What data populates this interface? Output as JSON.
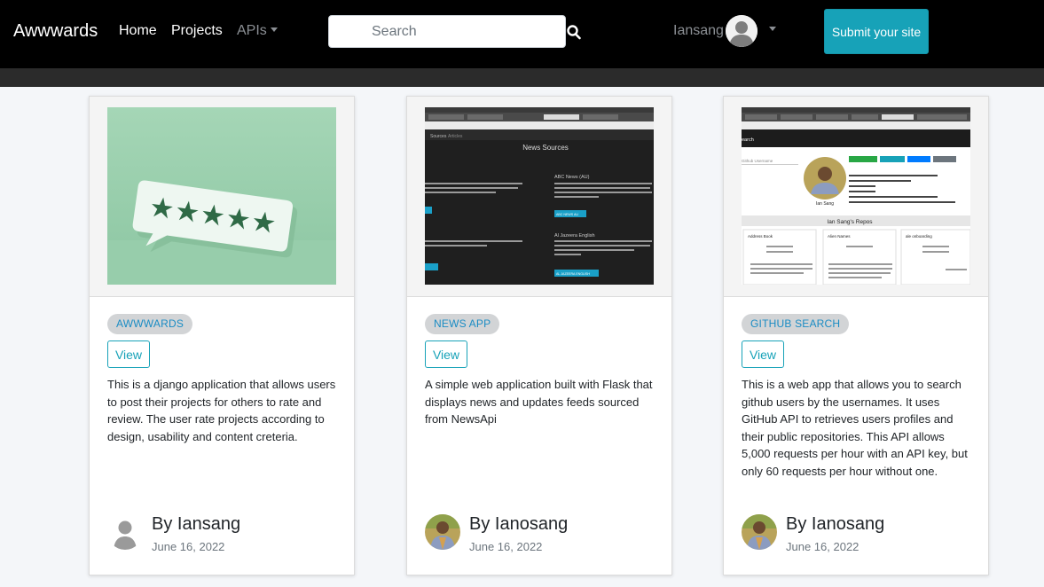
{
  "navbar": {
    "brand": "Awwwards",
    "links": {
      "home": "Home",
      "projects": "Projects",
      "apis": "APIs"
    },
    "search": {
      "placeholder": "Search",
      "value": ""
    },
    "user": {
      "name": "Iansang"
    },
    "submit_label": "Submit your site"
  },
  "colors": {
    "navbar": "#000000",
    "accent": "#17a2b8",
    "badge_bg": "#d2d4d6",
    "badge_text": "#1a8cc4"
  },
  "cards": [
    {
      "badge": "AWWWARDS",
      "view_label": "View",
      "description": "This is a django application that allows users to post their projects for others to rate and review. The user rate projects according to design, usability and content creteria.",
      "author": "By Iansang",
      "date": "June 16, 2022",
      "author_avatar": "default-user-icon",
      "thumbnail": "rating-stars-image"
    },
    {
      "badge": "NEWS APP",
      "view_label": "View",
      "description": "A simple web application built with Flask that displays news and updates feeds sourced from NewsApi",
      "author": "By Ianosang",
      "date": "June 16, 2022",
      "author_avatar": "profile-photo",
      "thumbnail": "news-app-screenshot",
      "thumbnail_text": {
        "header": "News Sources",
        "nav": [
          "Sources",
          "Articles"
        ],
        "source_1": "ABC News (AU)",
        "source_2": "Al Jazeera English",
        "button_1": "ABC NEWS AU",
        "button_2": "AL JAZEERA ENGLISH"
      }
    },
    {
      "badge": "GITHUB SEARCH",
      "view_label": "View",
      "description": "This is a web app that allows you to search github users by the usernames. It uses GitHub API to retrieves users profiles and their public repositories. This API allows 5,000 requests per hour with an API key, but only 60 requests per hour without one.",
      "author": "By Ianosang",
      "date": "June 16, 2022",
      "author_avatar": "profile-photo",
      "thumbnail": "github-search-screenshot",
      "thumbnail_text": {
        "search": "earch",
        "input": "Github Username",
        "profile_name": "Ian Sang",
        "repos_title": "Ian Sang's Repos",
        "repo_1": "Address Book",
        "repo_2": "Alien Names",
        "repo_3": "ale onboarding",
        "pills": [
          "16 Public Repos",
          "0 Public Gists",
          "12 Followers",
          "12 Following"
        ]
      }
    }
  ]
}
